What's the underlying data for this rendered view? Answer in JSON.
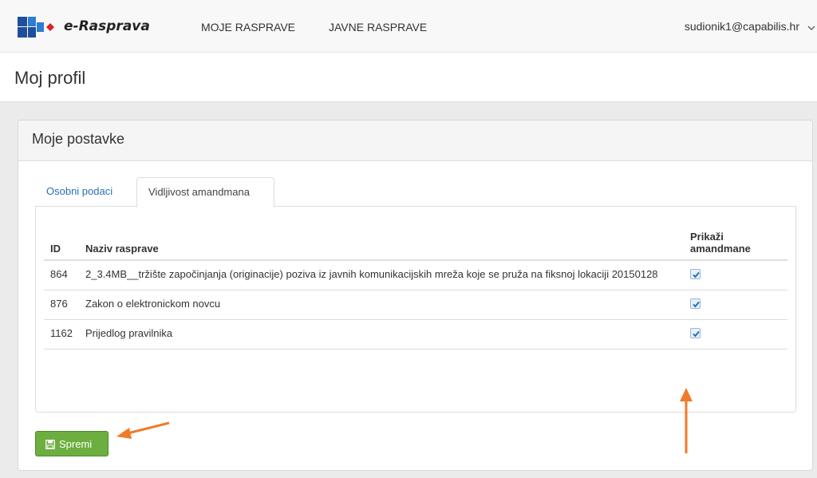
{
  "navbar": {
    "brand": "e-Rasprava",
    "links": [
      "MOJE RASPRAVE",
      "JAVNE RASPRAVE"
    ],
    "user": "sudionik1@capabilis.hr"
  },
  "page": {
    "title": "Moj profil"
  },
  "panel": {
    "title": "Moje postavke",
    "tabs": [
      "Osobni podaci",
      "Vidljivost amandmana"
    ],
    "active_tab": "Vidljivost amandmana"
  },
  "table": {
    "headers": {
      "id": "ID",
      "name": "Naziv rasprave",
      "show_line1": "Prikaži",
      "show_line2": "amandmane"
    },
    "rows": [
      {
        "id": "864",
        "name": "2_3.4MB__tržište započinjanja (originacije) poziva iz javnih komunikacijskih mreža koje se pruža na fiksnoj lokaciji 20150128",
        "checked": true
      },
      {
        "id": "876",
        "name": "Zakon o elektronickom novcu",
        "checked": true
      },
      {
        "id": "1162",
        "name": "Prijedlog pravilnika",
        "checked": true
      }
    ]
  },
  "save_button": {
    "label": "Spremi"
  },
  "colors": {
    "accent_arrow": "#f07a2a",
    "save_green": "#6cae3f",
    "link_blue": "#2a6fb8"
  }
}
